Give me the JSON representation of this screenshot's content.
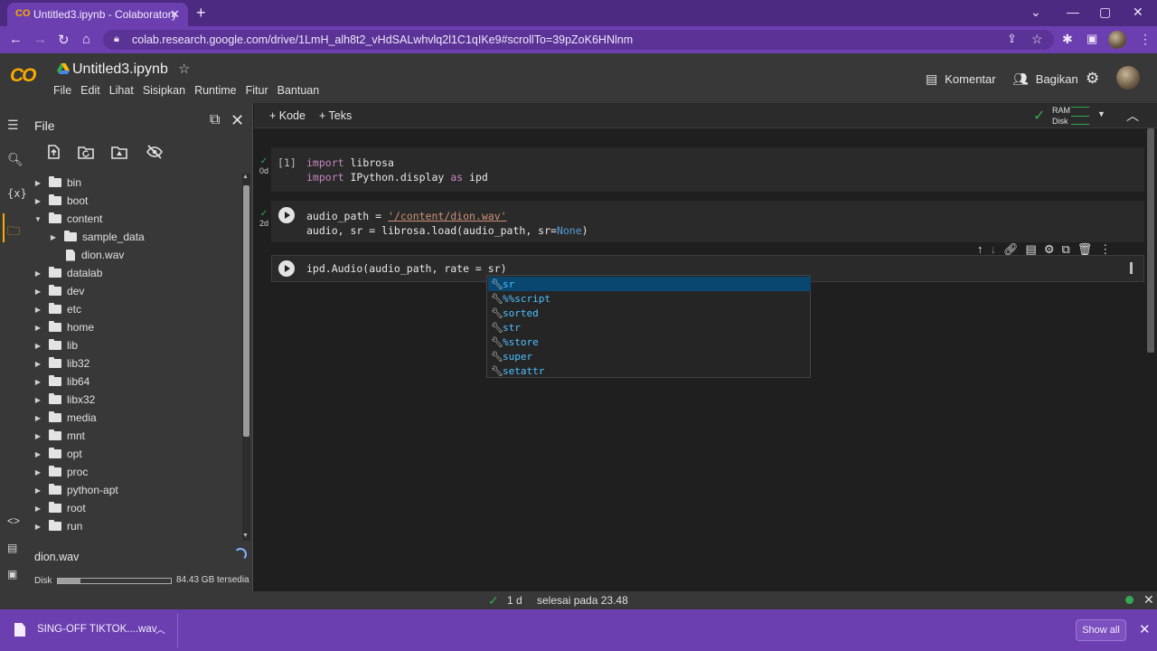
{
  "browser": {
    "tab_title": "Untitled3.ipynb - Colaboratory",
    "tab_favicon": "CO",
    "url": "colab.research.google.com/drive/1LmH_alh8t2_vHdSALwhvlq2l1C1qIKe9#scrollTo=39pZoK6HNlnm"
  },
  "colab": {
    "logo": "CO",
    "notebook_title": "Untitled3.ipynb",
    "menu": [
      "File",
      "Edit",
      "Lihat",
      "Sisipkan",
      "Runtime",
      "Fitur",
      "Bantuan"
    ],
    "comment_label": "Komentar",
    "share_label": "Bagikan"
  },
  "sidebar": {
    "title": "File",
    "tree": [
      {
        "name": "bin",
        "type": "folder",
        "depth": 0,
        "expanded": false
      },
      {
        "name": "boot",
        "type": "folder",
        "depth": 0,
        "expanded": false
      },
      {
        "name": "content",
        "type": "folder",
        "depth": 0,
        "expanded": true
      },
      {
        "name": "sample_data",
        "type": "folder",
        "depth": 1,
        "expanded": false
      },
      {
        "name": "dion.wav",
        "type": "file",
        "depth": 1
      },
      {
        "name": "datalab",
        "type": "folder",
        "depth": 0,
        "expanded": false
      },
      {
        "name": "dev",
        "type": "folder",
        "depth": 0,
        "expanded": false
      },
      {
        "name": "etc",
        "type": "folder",
        "depth": 0,
        "expanded": false
      },
      {
        "name": "home",
        "type": "folder",
        "depth": 0,
        "expanded": false
      },
      {
        "name": "lib",
        "type": "folder",
        "depth": 0,
        "expanded": false
      },
      {
        "name": "lib32",
        "type": "folder",
        "depth": 0,
        "expanded": false
      },
      {
        "name": "lib64",
        "type": "folder",
        "depth": 0,
        "expanded": false
      },
      {
        "name": "libx32",
        "type": "folder",
        "depth": 0,
        "expanded": false
      },
      {
        "name": "media",
        "type": "folder",
        "depth": 0,
        "expanded": false
      },
      {
        "name": "mnt",
        "type": "folder",
        "depth": 0,
        "expanded": false
      },
      {
        "name": "opt",
        "type": "folder",
        "depth": 0,
        "expanded": false
      },
      {
        "name": "proc",
        "type": "folder",
        "depth": 0,
        "expanded": false
      },
      {
        "name": "python-apt",
        "type": "folder",
        "depth": 0,
        "expanded": false
      },
      {
        "name": "root",
        "type": "folder",
        "depth": 0,
        "expanded": false
      },
      {
        "name": "run",
        "type": "folder",
        "depth": 0,
        "expanded": false
      }
    ],
    "uploading_file": "dion.wav",
    "disk_label": "Disk",
    "disk_used_fraction": 0.2,
    "disk_free": "84.43 GB tersedia"
  },
  "toolbar": {
    "add_code": "+ Kode",
    "add_text": "+ Teks",
    "ram_label": "RAM",
    "disk_label": "Disk"
  },
  "cells": [
    {
      "exec_label": "[1]",
      "time": "0d",
      "lines": [
        {
          "kw": "import",
          "rest": " librosa"
        },
        {
          "kw": "import",
          "rest": " IPython.display ",
          "kw2": "as",
          "rest2": " ipd"
        }
      ]
    },
    {
      "time": "2d",
      "line1_prefix": "audio_path = ",
      "line1_string": "'/content/dion.wav'",
      "line2_prefix": "audio, sr = librosa.load(audio_path, sr=",
      "line2_none": "None",
      "line2_suffix": ")"
    },
    {
      "code": "ipd.Audio(audio_path, rate = sr)"
    }
  ],
  "autocomplete": {
    "typed": "s",
    "items": [
      "sr",
      "%%script",
      "sorted",
      "str",
      "%store",
      "super",
      "setattr"
    ]
  },
  "statusbar": {
    "elapsed": "1 d",
    "done_text": "selesai pada 23.48"
  },
  "downloads": {
    "file_name": "SING-OFF TIKTOK....wav",
    "show_all": "Show all"
  },
  "colors": {
    "chrome_purple": "#6c3fb0",
    "colab_orange": "#f9ab00",
    "ok_green": "#34a853",
    "ac_selected": "#094771"
  }
}
